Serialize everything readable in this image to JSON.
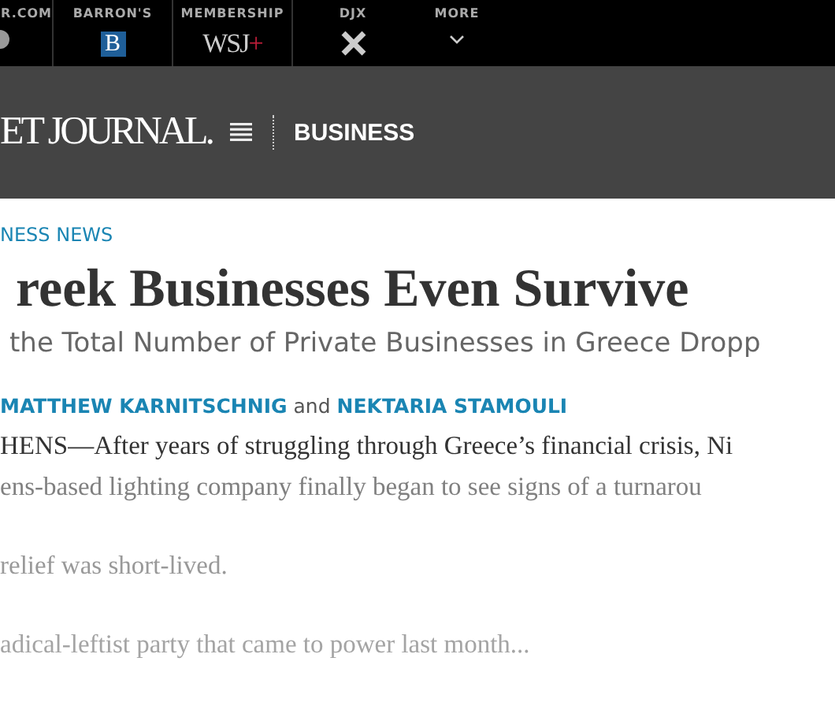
{
  "top_bar": {
    "items": [
      {
        "label": "R.COM",
        "kind": "partial"
      },
      {
        "label": "BARRON'S",
        "kind": "barrons",
        "logo_text": "B"
      },
      {
        "label": "MEMBERSHIP",
        "kind": "wsj",
        "logo_text": "WSJ",
        "logo_mark": "+"
      },
      {
        "label": "DJX",
        "kind": "djx"
      },
      {
        "label": "MORE",
        "kind": "more"
      }
    ]
  },
  "header": {
    "masthead": "ET JOURNAL.",
    "section": "BUSINESS"
  },
  "article": {
    "category": "NESS NEWS",
    "headline": "reek Businesses Even Survive",
    "subhead": "the Total Number of Private Businesses in Greece Dropp",
    "byline": {
      "authors": [
        "MATTHEW KARNITSCHNIG",
        "NEKTARIA STAMOULI"
      ],
      "joiner": "and"
    },
    "paragraphs": [
      {
        "text": "HENS—After years of struggling through Greece’s financial crisis, Ni",
        "kind": "full"
      },
      {
        "text": "ens-based lighting company finally began to see signs of a turnarou",
        "kind": "dim"
      },
      {
        "text": "relief was short-lived.",
        "kind": "faint"
      },
      {
        "text": "adical-leftist party that came to power last month...",
        "kind": "fainter"
      }
    ]
  }
}
